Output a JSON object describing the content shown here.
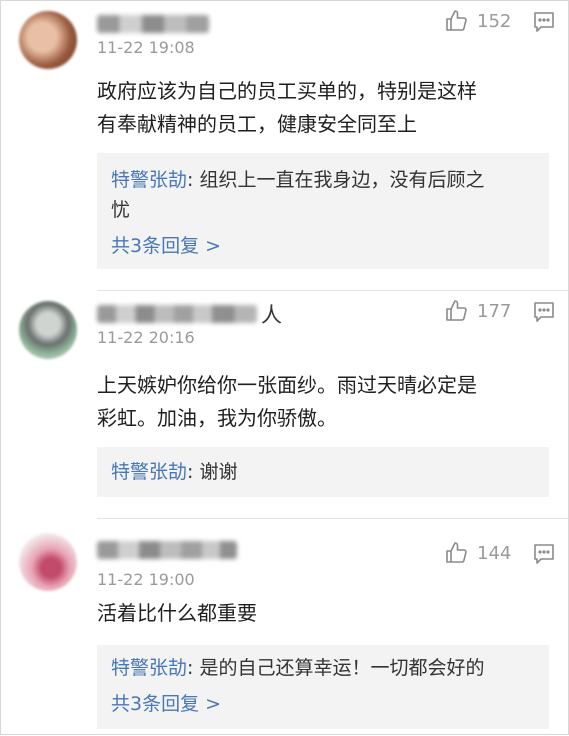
{
  "comments": [
    {
      "user_suffix": "",
      "time": "11-22 19:08",
      "likes": "152",
      "text_lines": [
        "政府应该为自己的员工买单的，特别是这样",
        "有奉献精神的员工，健康安全同至上"
      ],
      "reply": {
        "author": "特警张劼",
        "separator": ":",
        "lines": [
          " 组织上一直在我身边，没有后顾之",
          "忧"
        ],
        "more": "共3条回复 >"
      }
    },
    {
      "user_suffix": "人",
      "time": "11-22 20:16",
      "likes": "177",
      "text_lines": [
        "上天嫉妒你给你一张面纱。雨过天晴必定是",
        "彩虹。加油，我为你骄傲。"
      ],
      "reply": {
        "author": "特警张劼",
        "separator": ":",
        "lines": [
          " 谢谢"
        ],
        "more": ""
      }
    },
    {
      "user_suffix": "",
      "time": "11-22 19:00",
      "likes": "144",
      "text_lines": [
        "活着比什么都重要"
      ],
      "reply": {
        "author": "特警张劼",
        "separator": ":",
        "lines": [
          " 是的自己还算幸运！一切都会好的"
        ],
        "more": "共3条回复 >"
      }
    }
  ],
  "colors": {
    "link": "#4877b8",
    "meta": "#9a9a9a",
    "reply_bg": "#f3f3f3"
  },
  "icons": {
    "like": "thumbs-up-icon",
    "reply": "comment-bubble-icon"
  }
}
